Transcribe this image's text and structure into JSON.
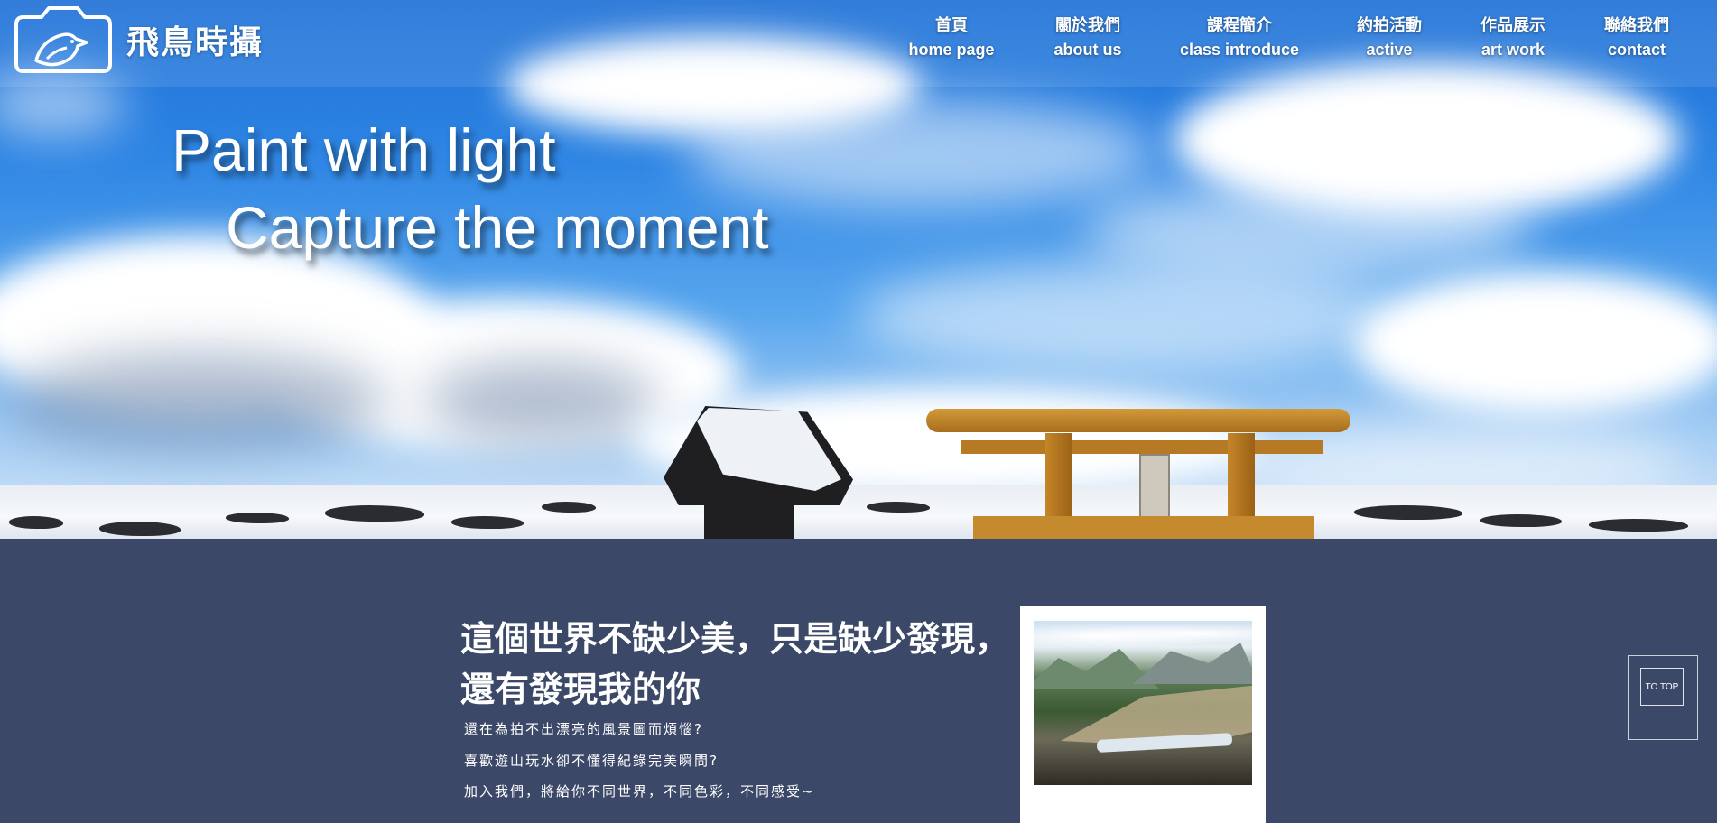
{
  "brand": {
    "name": "飛鳥時攝",
    "logo_icon": "camera-bird-icon"
  },
  "nav": {
    "items": [
      {
        "zh": "首頁",
        "en": "home page"
      },
      {
        "zh": "關於我們",
        "en": "about us"
      },
      {
        "zh": "課程簡介",
        "en": "class introduce"
      },
      {
        "zh": "約拍活動",
        "en": "active"
      },
      {
        "zh": "作品展示",
        "en": "art work"
      },
      {
        "zh": "聯絡我們",
        "en": "contact"
      }
    ]
  },
  "hero": {
    "line1": "Paint with light",
    "line2": "Capture the moment"
  },
  "intro": {
    "heading_line1": "這個世界不缺少美，只是缺少發現，",
    "heading_line2": "還有發現我的你",
    "lines": [
      "還在為拍不出漂亮的風景圖而煩惱?",
      "喜歡遊山玩水卻不懂得紀錄完美瞬間?",
      "加入我們，將給你不同世界，不同色彩，不同感受~"
    ]
  },
  "totop": {
    "label": "TO TOP"
  },
  "colors": {
    "content_bg": "#3b4867",
    "text": "#ffffff",
    "torii": "#c48628"
  }
}
